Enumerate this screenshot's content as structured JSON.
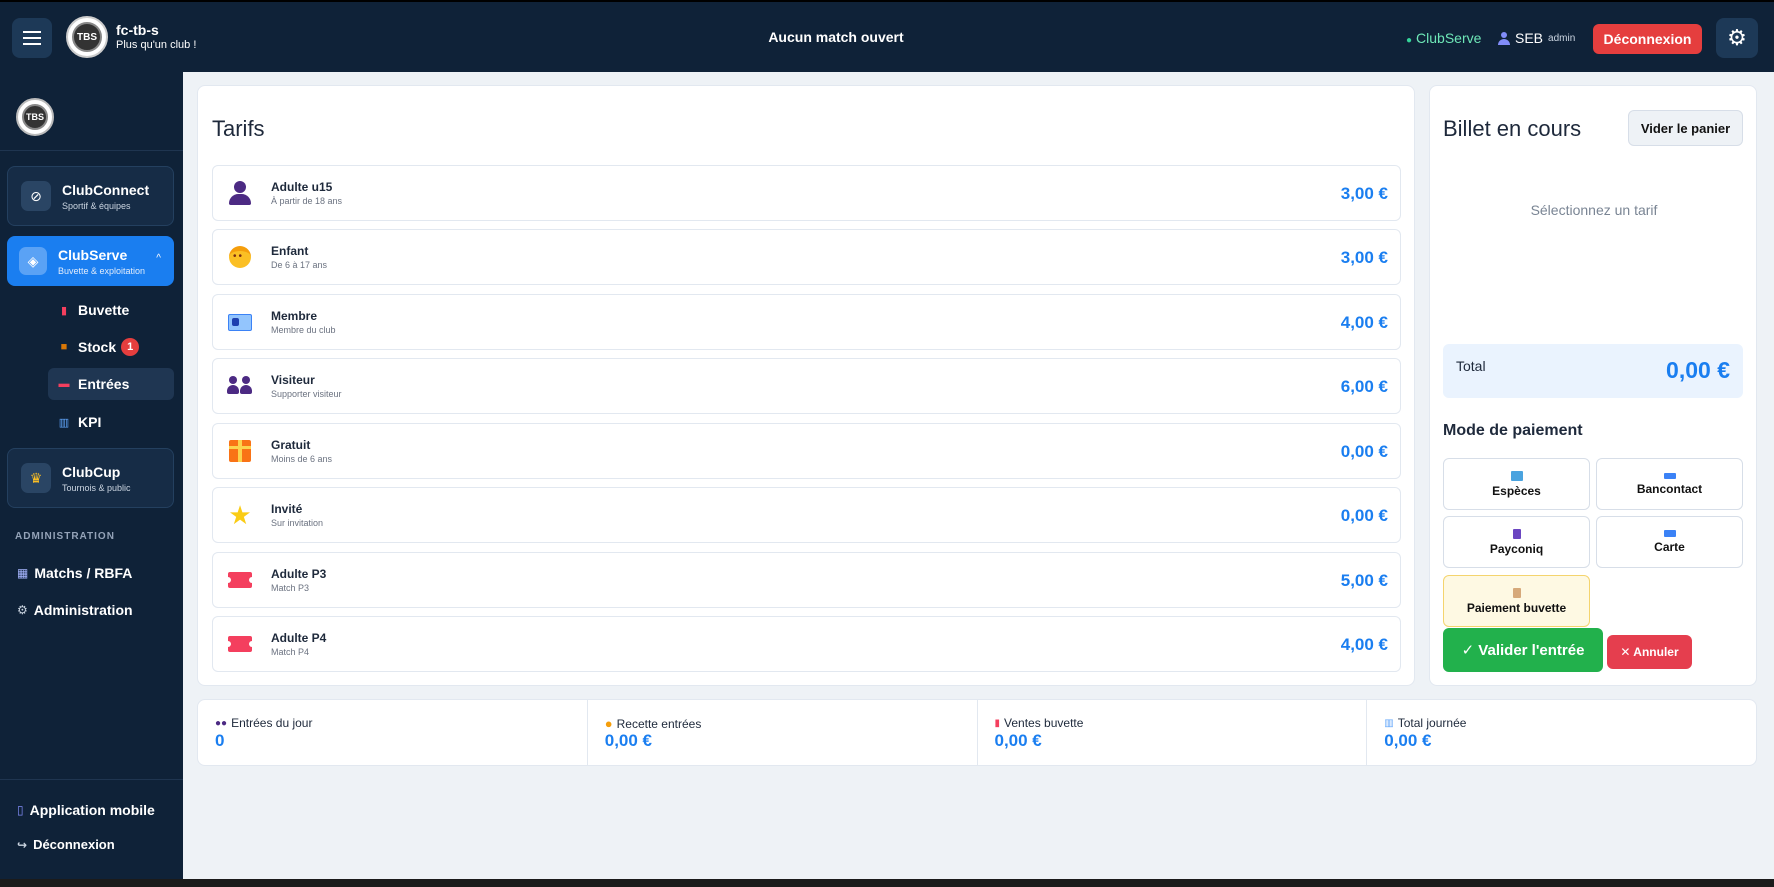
{
  "topbar": {
    "club_name": "fc-tb-s",
    "club_tagline": "Plus qu'un club !",
    "match_status": "Aucun match ouvert",
    "service": "ClubServe",
    "user_name": "SEB",
    "user_role": "admin",
    "logout_label": "Déconnexion",
    "logo_text": "TBS"
  },
  "sidebar": {
    "modules": [
      {
        "title": "ClubConnect",
        "subtitle": "Sportif & équipes",
        "icon": "link-icon"
      },
      {
        "title": "ClubServe",
        "subtitle": "Buvette & exploitation",
        "icon": "shield-icon"
      },
      {
        "title": "ClubCup",
        "subtitle": "Tournois & public",
        "icon": "trophy-icon"
      }
    ],
    "sub_items": [
      {
        "label": "Buvette",
        "icon": "drink-icon"
      },
      {
        "label": "Stock",
        "icon": "box-icon",
        "badge": "1"
      },
      {
        "label": "Entrées",
        "icon": "ticket-icon"
      },
      {
        "label": "KPI",
        "icon": "chart-icon"
      }
    ],
    "section_label": "ADMINISTRATION",
    "admin_links": [
      {
        "label": "Matchs / RBFA",
        "icon": "calendar-icon"
      },
      {
        "label": "Administration",
        "icon": "gear-icon"
      }
    ],
    "footer_links": [
      {
        "label": "Application mobile",
        "icon": "phone-icon"
      },
      {
        "label": "Déconnexion",
        "icon": "logout-icon"
      }
    ]
  },
  "tarifs": {
    "title": "Tarifs",
    "items": [
      {
        "name": "Adulte u15",
        "desc": "À partir de 18 ans",
        "price": "3,00 €",
        "icon": "person-icon"
      },
      {
        "name": "Enfant",
        "desc": "De 6 à 17 ans",
        "price": "3,00 €",
        "icon": "child-icon"
      },
      {
        "name": "Membre",
        "desc": "Membre du club",
        "price": "4,00 €",
        "icon": "id-card-icon"
      },
      {
        "name": "Visiteur",
        "desc": "Supporter visiteur",
        "price": "6,00 €",
        "icon": "group-icon"
      },
      {
        "name": "Gratuit",
        "desc": "Moins de 6 ans",
        "price": "0,00 €",
        "icon": "gift-icon"
      },
      {
        "name": "Invité",
        "desc": "Sur invitation",
        "price": "0,00 €",
        "icon": "star-icon"
      },
      {
        "name": "Adulte P3",
        "desc": "Match P3",
        "price": "5,00 €",
        "icon": "ticket-icon"
      },
      {
        "name": "Adulte P4",
        "desc": "Match P4",
        "price": "4,00 €",
        "icon": "ticket-icon"
      }
    ]
  },
  "billet": {
    "title": "Billet en cours",
    "clear_label": "Vider le panier",
    "empty_message": "Sélectionnez un tarif",
    "total_label": "Total",
    "total_value": "0,00 €",
    "payment_title": "Mode de paiement",
    "payment_methods": [
      {
        "label": "Espèces",
        "icon": "cash-icon",
        "color": "#4aa3df"
      },
      {
        "label": "Bancontact",
        "icon": "card-icon",
        "color": "#3b82f6"
      },
      {
        "label": "Payconiq",
        "icon": "phone-icon",
        "color": "#6b46c1"
      },
      {
        "label": "Carte",
        "icon": "credit-card-icon",
        "color": "#3b82f6"
      },
      {
        "label": "Paiement buvette",
        "icon": "drink-icon",
        "color": "#d6a97a"
      }
    ],
    "validate_label": "✓ Valider l'entrée",
    "cancel_label": "✕ Annuler"
  },
  "stats": [
    {
      "label": "Entrées du jour",
      "value": "0",
      "icon": "group-icon"
    },
    {
      "label": "Recette entrées",
      "value": "0,00 €",
      "icon": "coin-icon"
    },
    {
      "label": "Ventes buvette",
      "value": "0,00 €",
      "icon": "drink-icon"
    },
    {
      "label": "Total journée",
      "value": "0,00 €",
      "icon": "chart-icon"
    }
  ],
  "colors": {
    "accent": "#1a7ef0",
    "navy": "#0f2238",
    "danger": "#e53e3e",
    "success": "#22b14c"
  }
}
